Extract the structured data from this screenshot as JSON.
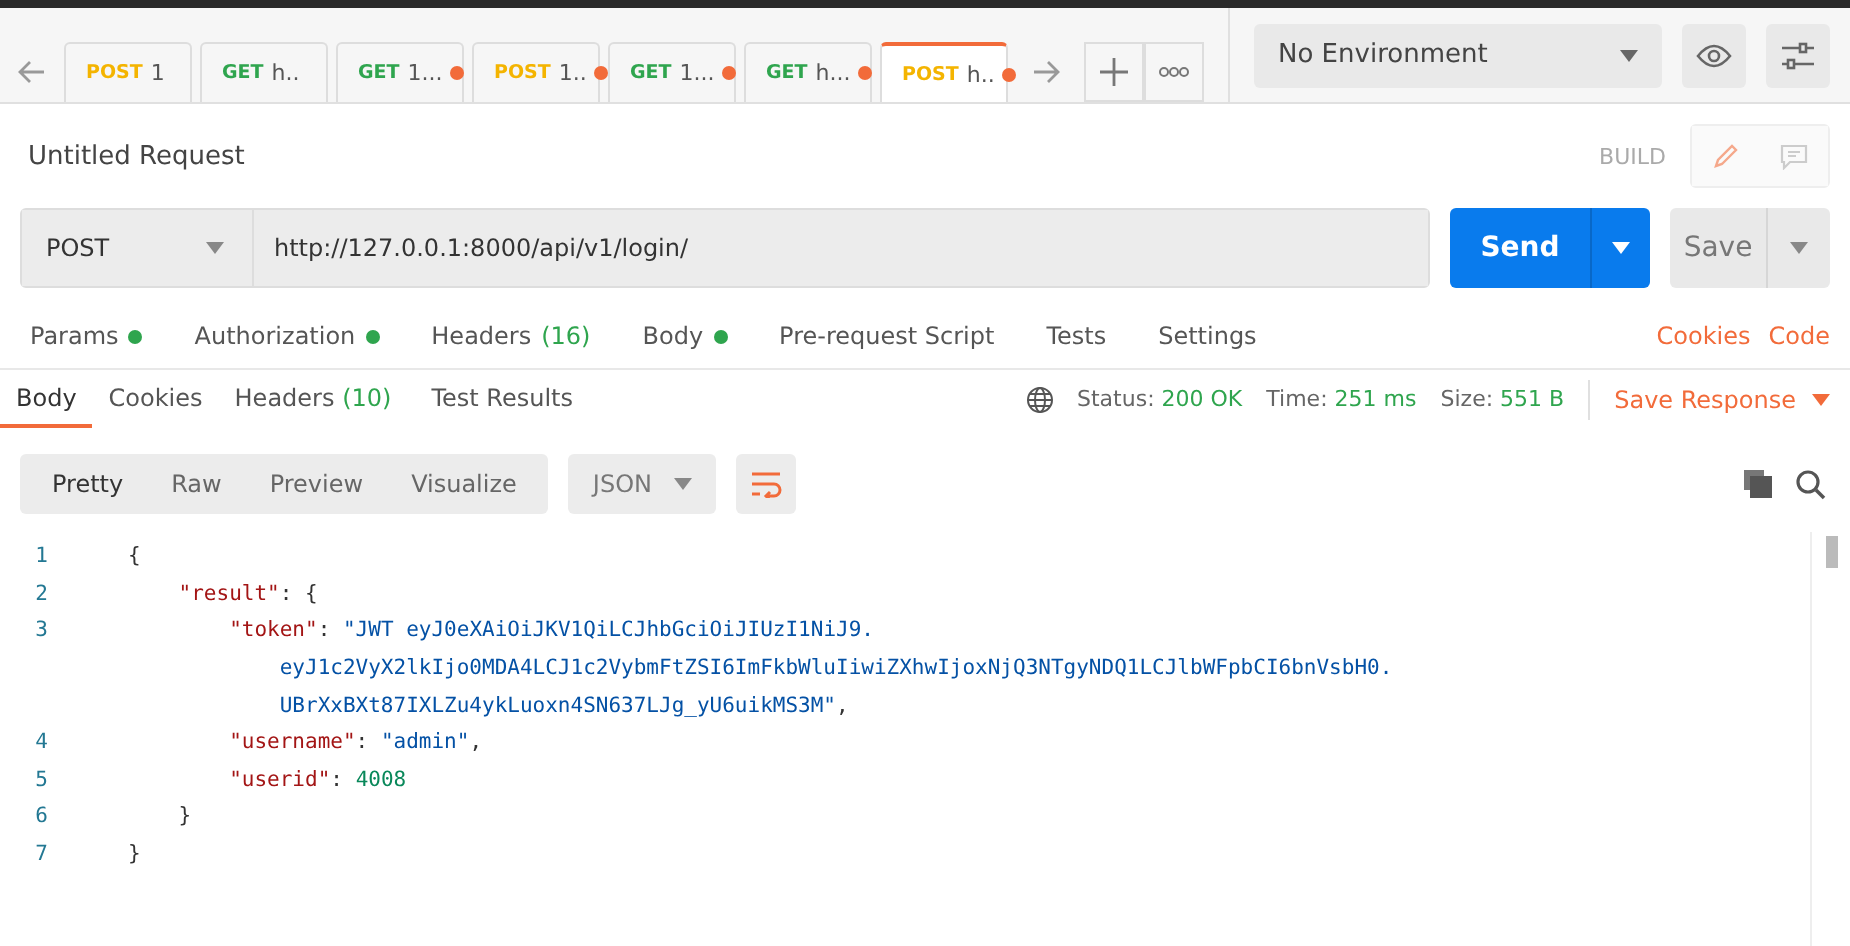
{
  "tabs": [
    {
      "method": "POST",
      "color": "#f4b400",
      "name": "1",
      "unsaved": false,
      "selected": false
    },
    {
      "method": "GET",
      "color": "#2fa54e",
      "name": "h..",
      "unsaved": false,
      "selected": false
    },
    {
      "method": "GET",
      "color": "#2fa54e",
      "name": "1...",
      "unsaved": true,
      "selected": false
    },
    {
      "method": "POST",
      "color": "#f4b400",
      "name": "1..",
      "unsaved": true,
      "selected": false
    },
    {
      "method": "GET",
      "color": "#2fa54e",
      "name": "1...",
      "unsaved": true,
      "selected": false
    },
    {
      "method": "GET",
      "color": "#2fa54e",
      "name": "h...",
      "unsaved": true,
      "selected": false
    },
    {
      "method": "POST",
      "color": "#f4b400",
      "name": "h..",
      "unsaved": true,
      "selected": true
    }
  ],
  "environment": {
    "value": "No Environment"
  },
  "request": {
    "title": "Untitled Request",
    "mode": "BUILD",
    "method": "POST",
    "url": "http://127.0.0.1:8000/api/v1/login/",
    "send": "Send",
    "save": "Save"
  },
  "request_tabs": [
    {
      "label": "Params",
      "dot": true
    },
    {
      "label": "Authorization",
      "dot": true
    },
    {
      "label": "Headers",
      "count": "(16)",
      "dot": false
    },
    {
      "label": "Body",
      "dot": true
    },
    {
      "label": "Pre-request Script",
      "dot": false
    },
    {
      "label": "Tests",
      "dot": false
    },
    {
      "label": "Settings",
      "dot": false
    }
  ],
  "request_links": [
    "Cookies",
    "Code"
  ],
  "response_tabs": [
    {
      "label": "Body",
      "selected": true
    },
    {
      "label": "Cookies",
      "selected": false
    },
    {
      "label": "Headers",
      "count": "(10)",
      "selected": false
    },
    {
      "label": "Test Results",
      "selected": false
    }
  ],
  "response_meta": [
    {
      "label": "Status:",
      "value": "200 OK"
    },
    {
      "label": "Time:",
      "value": "251 ms"
    },
    {
      "label": "Size:",
      "value": "551 B"
    }
  ],
  "save_response": "Save Response",
  "view_modes": [
    {
      "label": "Pretty",
      "selected": true
    },
    {
      "label": "Raw",
      "selected": false
    },
    {
      "label": "Preview",
      "selected": false
    },
    {
      "label": "Visualize",
      "selected": false
    }
  ],
  "format": "JSON",
  "code_lines": [
    {
      "number": "1",
      "tokens": [
        {
          "kind": "punct",
          "text": "{"
        }
      ]
    },
    {
      "number": "2",
      "tokens": [
        {
          "kind": "key",
          "text": "    \"result\""
        },
        {
          "kind": "punct",
          "text": ": {"
        }
      ]
    },
    {
      "number": "3",
      "tokens": [
        {
          "kind": "key",
          "text": "        \"token\""
        },
        {
          "kind": "punct",
          "text": ": "
        },
        {
          "kind": "string",
          "text": "\"JWT eyJ0eXAiOiJKV1QiLCJhbGciOiJIUzI1NiJ9."
        }
      ]
    },
    {
      "tokens": [
        {
          "kind": "string",
          "text": "            eyJ1c2VyX2lkIjo0MDA4LCJ1c2VybmFtZSI6ImFkbWluIiwiZXhwIjoxNjQ3NTgyNDQ1LCJlbWFpbCI6bnVsbH0."
        }
      ]
    },
    {
      "tokens": [
        {
          "kind": "string",
          "text": "            UBrXxBXt87IXLZu4ykLuoxn4SN637LJg_yU6uikMS3M\""
        },
        {
          "kind": "punct",
          "text": ","
        }
      ]
    },
    {
      "number": "4",
      "tokens": [
        {
          "kind": "key",
          "text": "        \"username\""
        },
        {
          "kind": "punct",
          "text": ": "
        },
        {
          "kind": "string",
          "text": "\"admin\""
        },
        {
          "kind": "punct",
          "text": ","
        }
      ]
    },
    {
      "number": "5",
      "tokens": [
        {
          "kind": "key",
          "text": "        \"userid\""
        },
        {
          "kind": "punct",
          "text": ": "
        },
        {
          "kind": "number",
          "text": "4008"
        }
      ]
    },
    {
      "number": "6",
      "tokens": [
        {
          "kind": "punct",
          "text": "    }"
        }
      ]
    },
    {
      "number": "7",
      "tokens": [
        {
          "kind": "punct",
          "text": "}"
        }
      ]
    }
  ]
}
